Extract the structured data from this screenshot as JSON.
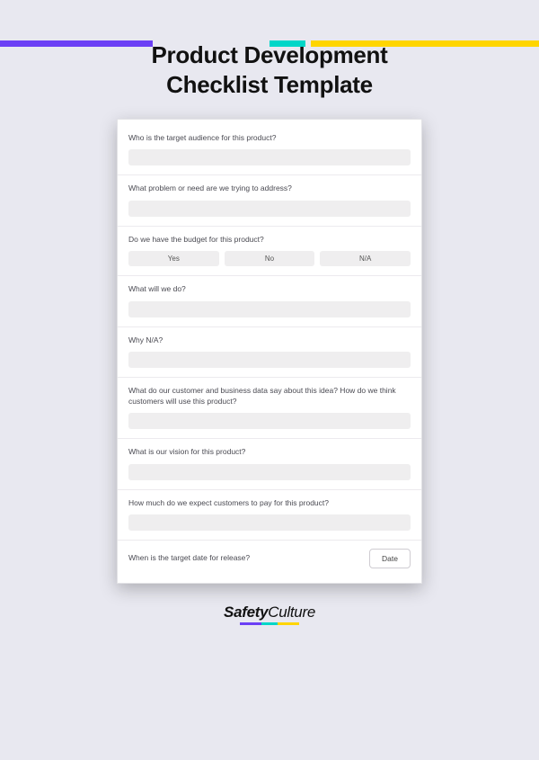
{
  "title_line1": "Product Development",
  "title_line2": "Checklist Template",
  "questions": {
    "q1": "Who is the target audience for this product?",
    "q2": "What problem or need are we trying to address?",
    "q3": "Do we have the budget for this product?",
    "q3_opts": {
      "yes": "Yes",
      "no": "No",
      "na": "N/A"
    },
    "q4": "What will we do?",
    "q5": "Why N/A?",
    "q6": "What do our customer and business data say about this idea? How do we think customers will use this product?",
    "q7": "What is our vision for this product?",
    "q8": "How much do we expect customers to pay for this product?",
    "q9": "When is the target date for release?",
    "date_btn": "Date"
  },
  "logo": {
    "part1": "Safety",
    "part2": "Culture"
  }
}
